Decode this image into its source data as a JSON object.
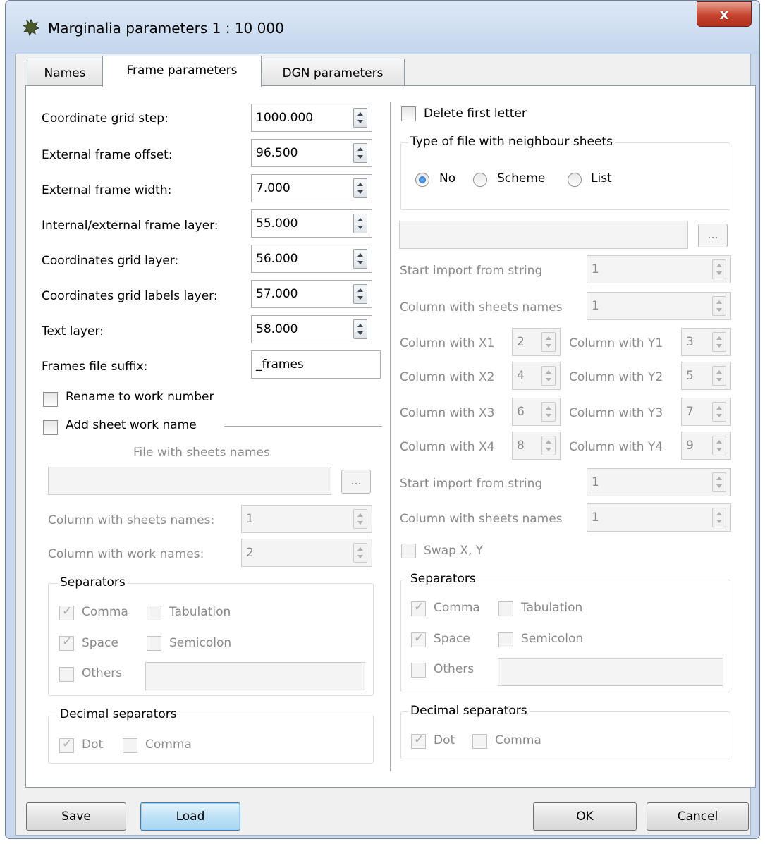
{
  "window": {
    "title": "Marginalia parameters 1 : 10 000",
    "icon": "app-tree-icon",
    "close_label": "x"
  },
  "tabs": [
    {
      "label": "Names"
    },
    {
      "label": "Frame parameters",
      "active": true
    },
    {
      "label": "DGN parameters"
    }
  ],
  "left": {
    "fields": [
      {
        "label": "Coordinate grid step:",
        "value": "1000.000"
      },
      {
        "label": "External frame offset:",
        "value": "96.500"
      },
      {
        "label": "External frame width:",
        "value": "7.000"
      },
      {
        "label": "Internal/external frame layer:",
        "value": "55.000"
      },
      {
        "label": "Coordinates grid layer:",
        "value": "56.000"
      },
      {
        "label": "Coordinates grid labels layer:",
        "value": "57.000"
      },
      {
        "label": "Text layer:",
        "value": "58.000"
      }
    ],
    "suffix_label": "Frames file suffix:",
    "suffix_value": "_frames",
    "rename_label": "Rename to work number",
    "add_sheet_label": "Add sheet work name",
    "file_label": "File with sheets names",
    "file_value": "",
    "browse_label": "...",
    "col_sheets_label": "Column with sheets names:",
    "col_sheets_value": "1",
    "col_work_label": "Column with work names:",
    "col_work_value": "2",
    "separators": {
      "title": "Separators",
      "comma": "Comma",
      "tabulation": "Tabulation",
      "space": "Space",
      "semicolon": "Semicolon",
      "others": "Others",
      "others_value": ""
    },
    "decimal": {
      "title": "Decimal separators",
      "dot": "Dot",
      "comma": "Comma"
    }
  },
  "right": {
    "delete_first_label": "Delete first letter",
    "type_group_title": "Type of file with neighbour sheets",
    "radio_no": "No",
    "radio_scheme": "Scheme",
    "radio_list": "List",
    "file_value": "",
    "browse_label": "...",
    "start_import_label": "Start import from string",
    "start_import_value": "1",
    "col_names_label": "Column with sheets names",
    "col_names_value": "1",
    "coords": [
      {
        "xlabel": "Column with X1",
        "xval": "2",
        "ylabel": "Column with Y1",
        "yval": "3"
      },
      {
        "xlabel": "Column with X2",
        "xval": "4",
        "ylabel": "Column with Y2",
        "yval": "5"
      },
      {
        "xlabel": "Column with X3",
        "xval": "6",
        "ylabel": "Column with Y3",
        "yval": "7"
      },
      {
        "xlabel": "Column with X4",
        "xval": "8",
        "ylabel": "Column with Y4",
        "yval": "9"
      }
    ],
    "start_import2_label": "Start import from string",
    "start_import2_value": "1",
    "col_names2_label": "Column with sheets names",
    "col_names2_value": "1",
    "swap_label": "Swap X, Y",
    "separators": {
      "title": "Separators",
      "comma": "Comma",
      "tabulation": "Tabulation",
      "space": "Space",
      "semicolon": "Semicolon",
      "others": "Others",
      "others_value": ""
    },
    "decimal": {
      "title": "Decimal separators",
      "dot": "Dot",
      "comma": "Comma"
    }
  },
  "footer": {
    "save": "Save",
    "load": "Load",
    "ok": "OK",
    "cancel": "Cancel"
  }
}
